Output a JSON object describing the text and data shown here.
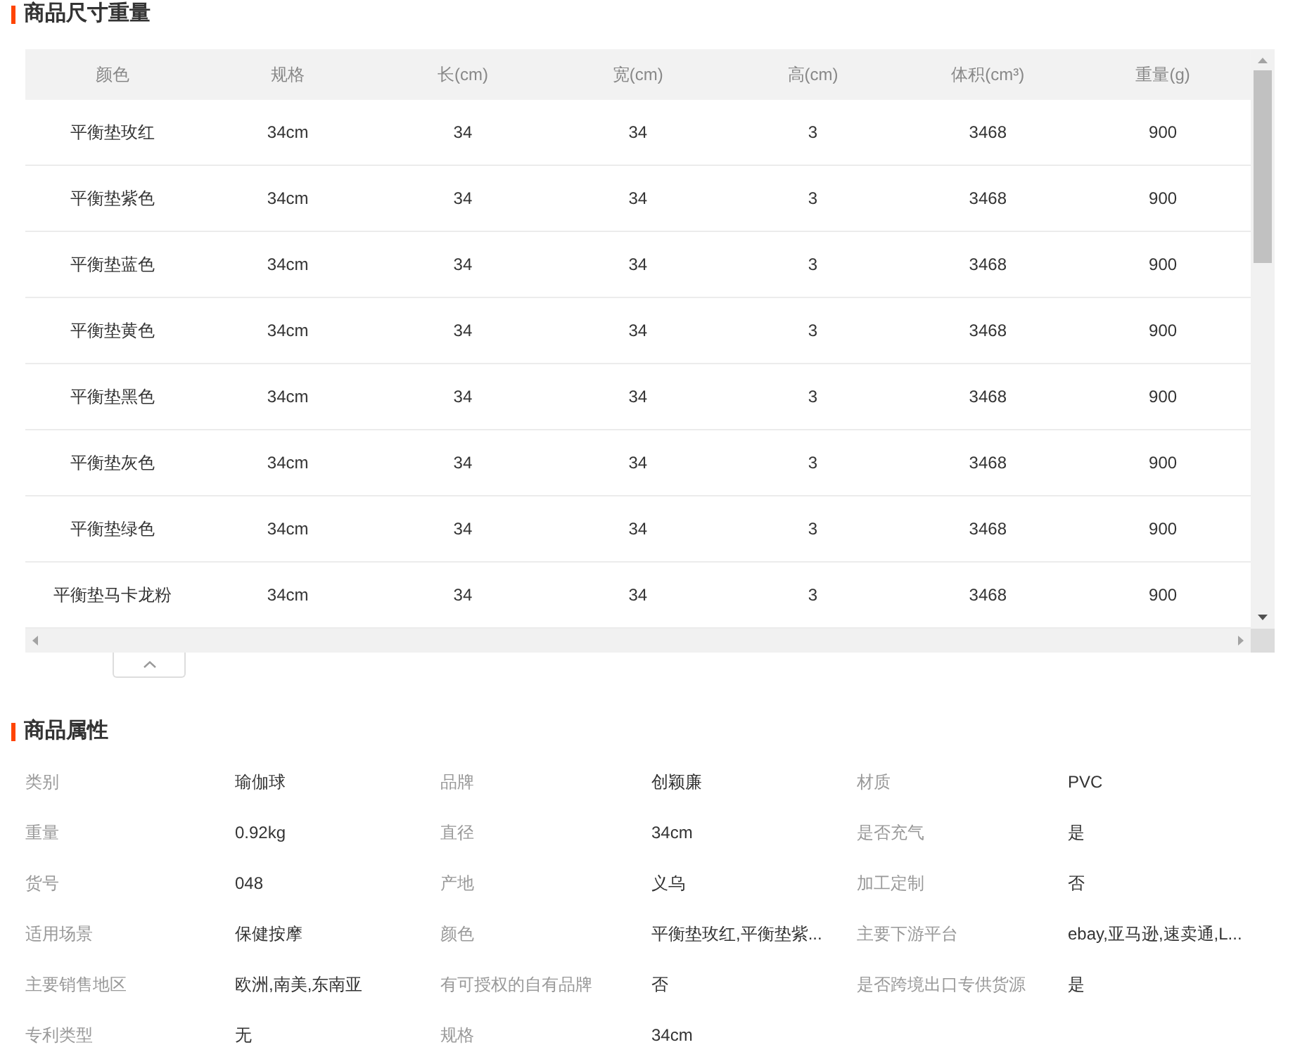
{
  "size_section": {
    "title": "商品尺寸重量",
    "table": {
      "columns": [
        "颜色",
        "规格",
        "长(cm)",
        "宽(cm)",
        "高(cm)",
        "体积(cm³)",
        "重量(g)"
      ],
      "rows": [
        [
          "平衡垫玫红",
          "34cm",
          "34",
          "34",
          "3",
          "3468",
          "900"
        ],
        [
          "平衡垫紫色",
          "34cm",
          "34",
          "34",
          "3",
          "3468",
          "900"
        ],
        [
          "平衡垫蓝色",
          "34cm",
          "34",
          "34",
          "3",
          "3468",
          "900"
        ],
        [
          "平衡垫黄色",
          "34cm",
          "34",
          "34",
          "3",
          "3468",
          "900"
        ],
        [
          "平衡垫黑色",
          "34cm",
          "34",
          "34",
          "3",
          "3468",
          "900"
        ],
        [
          "平衡垫灰色",
          "34cm",
          "34",
          "34",
          "3",
          "3468",
          "900"
        ],
        [
          "平衡垫绿色",
          "34cm",
          "34",
          "34",
          "3",
          "3468",
          "900"
        ],
        [
          "平衡垫马卡龙粉",
          "34cm",
          "34",
          "34",
          "3",
          "3468",
          "900"
        ]
      ]
    }
  },
  "attributes_section": {
    "title": "商品属性",
    "items": [
      {
        "label": "类别",
        "value": "瑜伽球"
      },
      {
        "label": "品牌",
        "value": "创颖廉"
      },
      {
        "label": "材质",
        "value": "PVC"
      },
      {
        "label": "重量",
        "value": "0.92kg"
      },
      {
        "label": "直径",
        "value": "34cm"
      },
      {
        "label": "是否充气",
        "value": "是"
      },
      {
        "label": "货号",
        "value": "048"
      },
      {
        "label": "产地",
        "value": "义乌"
      },
      {
        "label": "加工定制",
        "value": "否"
      },
      {
        "label": "适用场景",
        "value": "保健按摩"
      },
      {
        "label": "颜色",
        "value": "平衡垫玫红,平衡垫紫..."
      },
      {
        "label": "主要下游平台",
        "value": "ebay,亚马逊,速卖通,L..."
      },
      {
        "label": "主要销售地区",
        "value": "欧洲,南美,东南亚"
      },
      {
        "label": "有可授权的自有品牌",
        "value": "否"
      },
      {
        "label": "是否跨境出口专供货源",
        "value": "是"
      },
      {
        "label": "专利类型",
        "value": "无"
      },
      {
        "label": "规格",
        "value": "34cm"
      }
    ]
  }
}
